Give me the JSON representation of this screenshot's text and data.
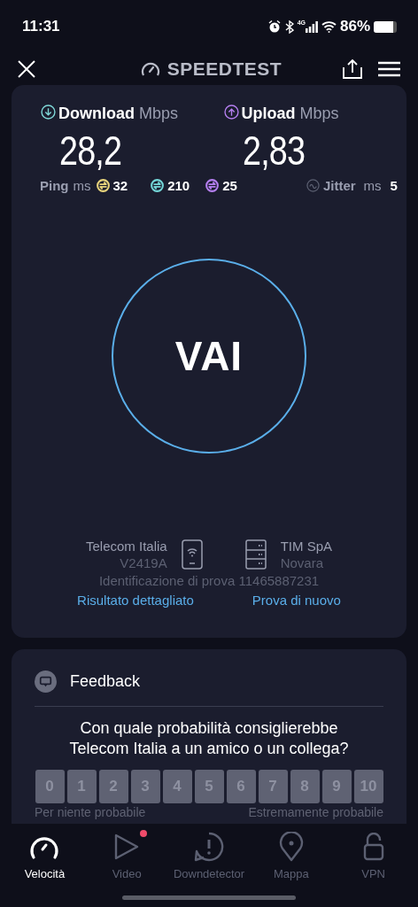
{
  "status_bar": {
    "time": "11:31",
    "network": "4G",
    "battery": "86%"
  },
  "header": {
    "title": "SPEEDTEST"
  },
  "results": [
    {
      "kind": "download",
      "label": "Download",
      "unit": "Mbps",
      "value": "28,2",
      "color": "#7fd8d8"
    },
    {
      "kind": "upload",
      "label": "Upload",
      "unit": "Mbps",
      "value": "2,83",
      "color": "#b57ff0"
    }
  ],
  "ping": {
    "label": "Ping",
    "unit": "ms",
    "values": [
      {
        "value": "32",
        "color": "#e9d47c"
      },
      {
        "value": "210",
        "color": "#74d6d8"
      },
      {
        "value": "25",
        "color": "#b57ff0"
      }
    ]
  },
  "jitter": {
    "label": "Jitter",
    "unit": "ms",
    "value": "5"
  },
  "go_button": "VAI",
  "connection": {
    "isp": "Telecom Italia",
    "device": "V2419A",
    "server": "TIM SpA",
    "city": "Novara",
    "test_id": "Identificazione di prova 11465887231",
    "links": [
      "Risultato dettagliato",
      "Prova di nuovo"
    ]
  },
  "feedback": {
    "title": "Feedback",
    "question": "Con quale probabilità consiglierebbe Telecom Italia a un amico o un collega?",
    "scale": [
      "0",
      "1",
      "2",
      "3",
      "4",
      "5",
      "6",
      "7",
      "8",
      "9",
      "10"
    ],
    "low_label": "Per niente probabile",
    "high_label": "Estremamente probabile"
  },
  "nav": [
    {
      "kind": "gauge",
      "label": "Velocità",
      "selected": true,
      "badge": false
    },
    {
      "kind": "play",
      "label": "Video",
      "selected": false,
      "badge": true
    },
    {
      "kind": "alert",
      "label": "Downdetector",
      "selected": false,
      "badge": false
    },
    {
      "kind": "pin",
      "label": "Mappa",
      "selected": false,
      "badge": false
    },
    {
      "kind": "lock",
      "label": "VPN",
      "selected": false,
      "badge": false
    }
  ]
}
